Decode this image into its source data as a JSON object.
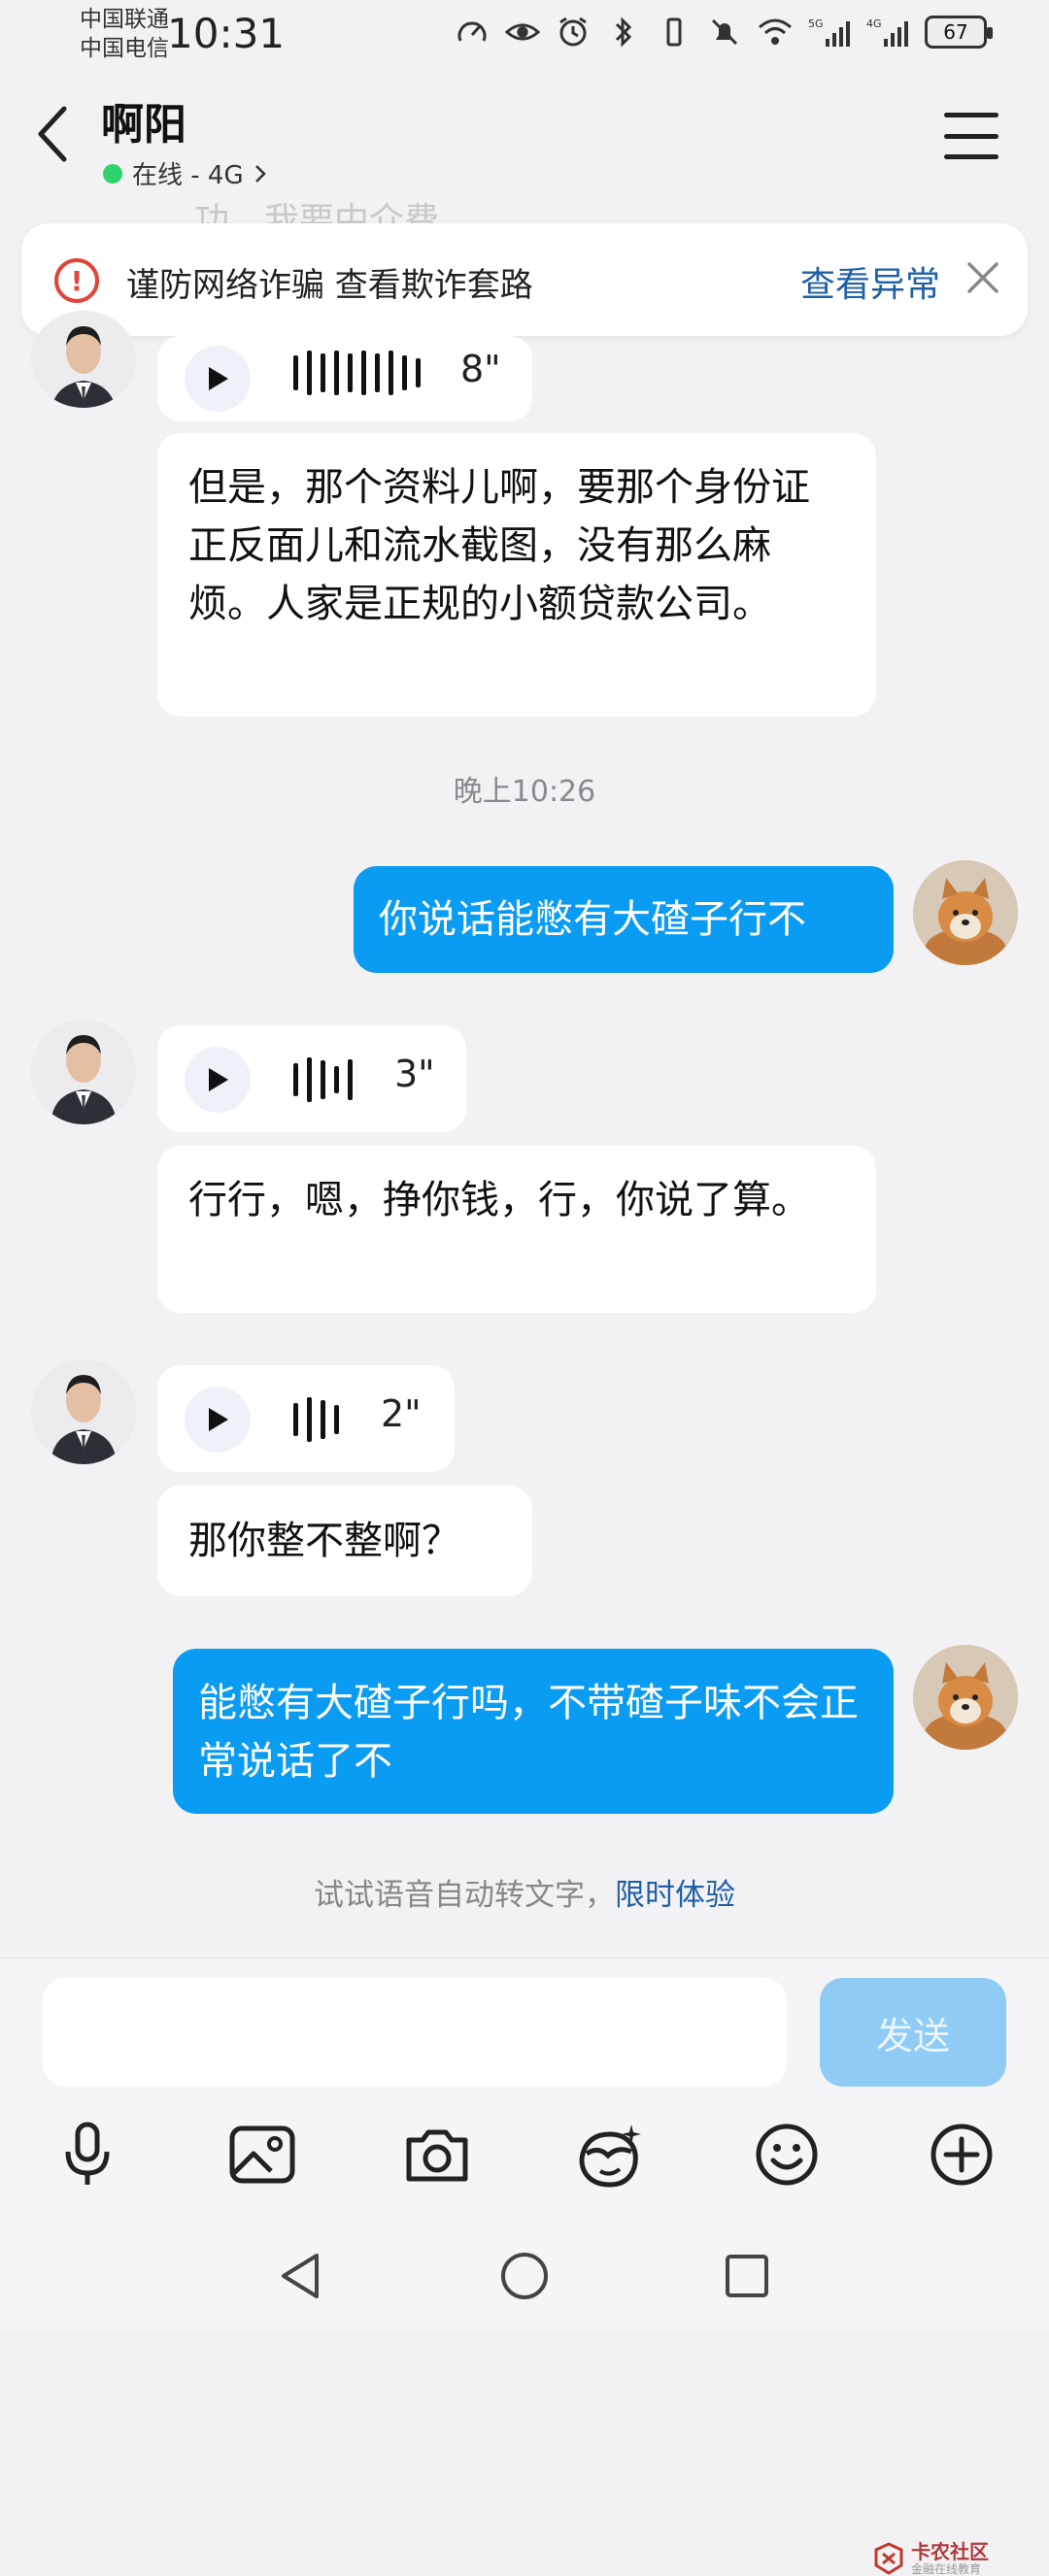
{
  "status_bar": {
    "carrier_1": "中国联通",
    "carrier_2": "中国电信",
    "time": "10:31",
    "network_1": "5G",
    "network_2": "4G",
    "battery": "67"
  },
  "header": {
    "contact_name": "啊阳",
    "online_status": "在线 - 4G",
    "online_color": "#2ed36d"
  },
  "partial_message_top": "功，我要中介费。",
  "fraud_banner": {
    "text": "谨防网络诈骗 查看欺诈套路",
    "link": "查看异常"
  },
  "messages": {
    "m1_voice_duration": "8\"",
    "m1_text": "但是，那个资料儿啊，要那个身份证正反面儿和流水截图，没有那么麻烦。人家是正规的小额贷款公司。",
    "timestamp": "晚上10:26",
    "m2_out_text": "你说话能憋有大碴子行不",
    "m3_voice_duration": "3\"",
    "m3_text": "行行，嗯，挣你钱，行，你说了算。",
    "m4_voice_duration": "2\"",
    "m4_text": "那你整不整啊？",
    "m5_out_text": "能憋有大碴子行吗，不带碴子味不会正常说话了不"
  },
  "hint": {
    "text": "试试语音自动转文字，",
    "link": "限时体验"
  },
  "input": {
    "placeholder": "",
    "send_label": "发送"
  },
  "toolbar": {
    "icons": [
      "microphone-icon",
      "image-icon",
      "camera-icon",
      "sticker-icon",
      "emoji-icon",
      "plus-icon"
    ]
  },
  "watermark": {
    "title": "卡农社区",
    "subtitle": "金融在线教育"
  },
  "colors": {
    "accent": "#0a9bf3",
    "link": "#1f5fa8",
    "warning": "#e0443a"
  }
}
